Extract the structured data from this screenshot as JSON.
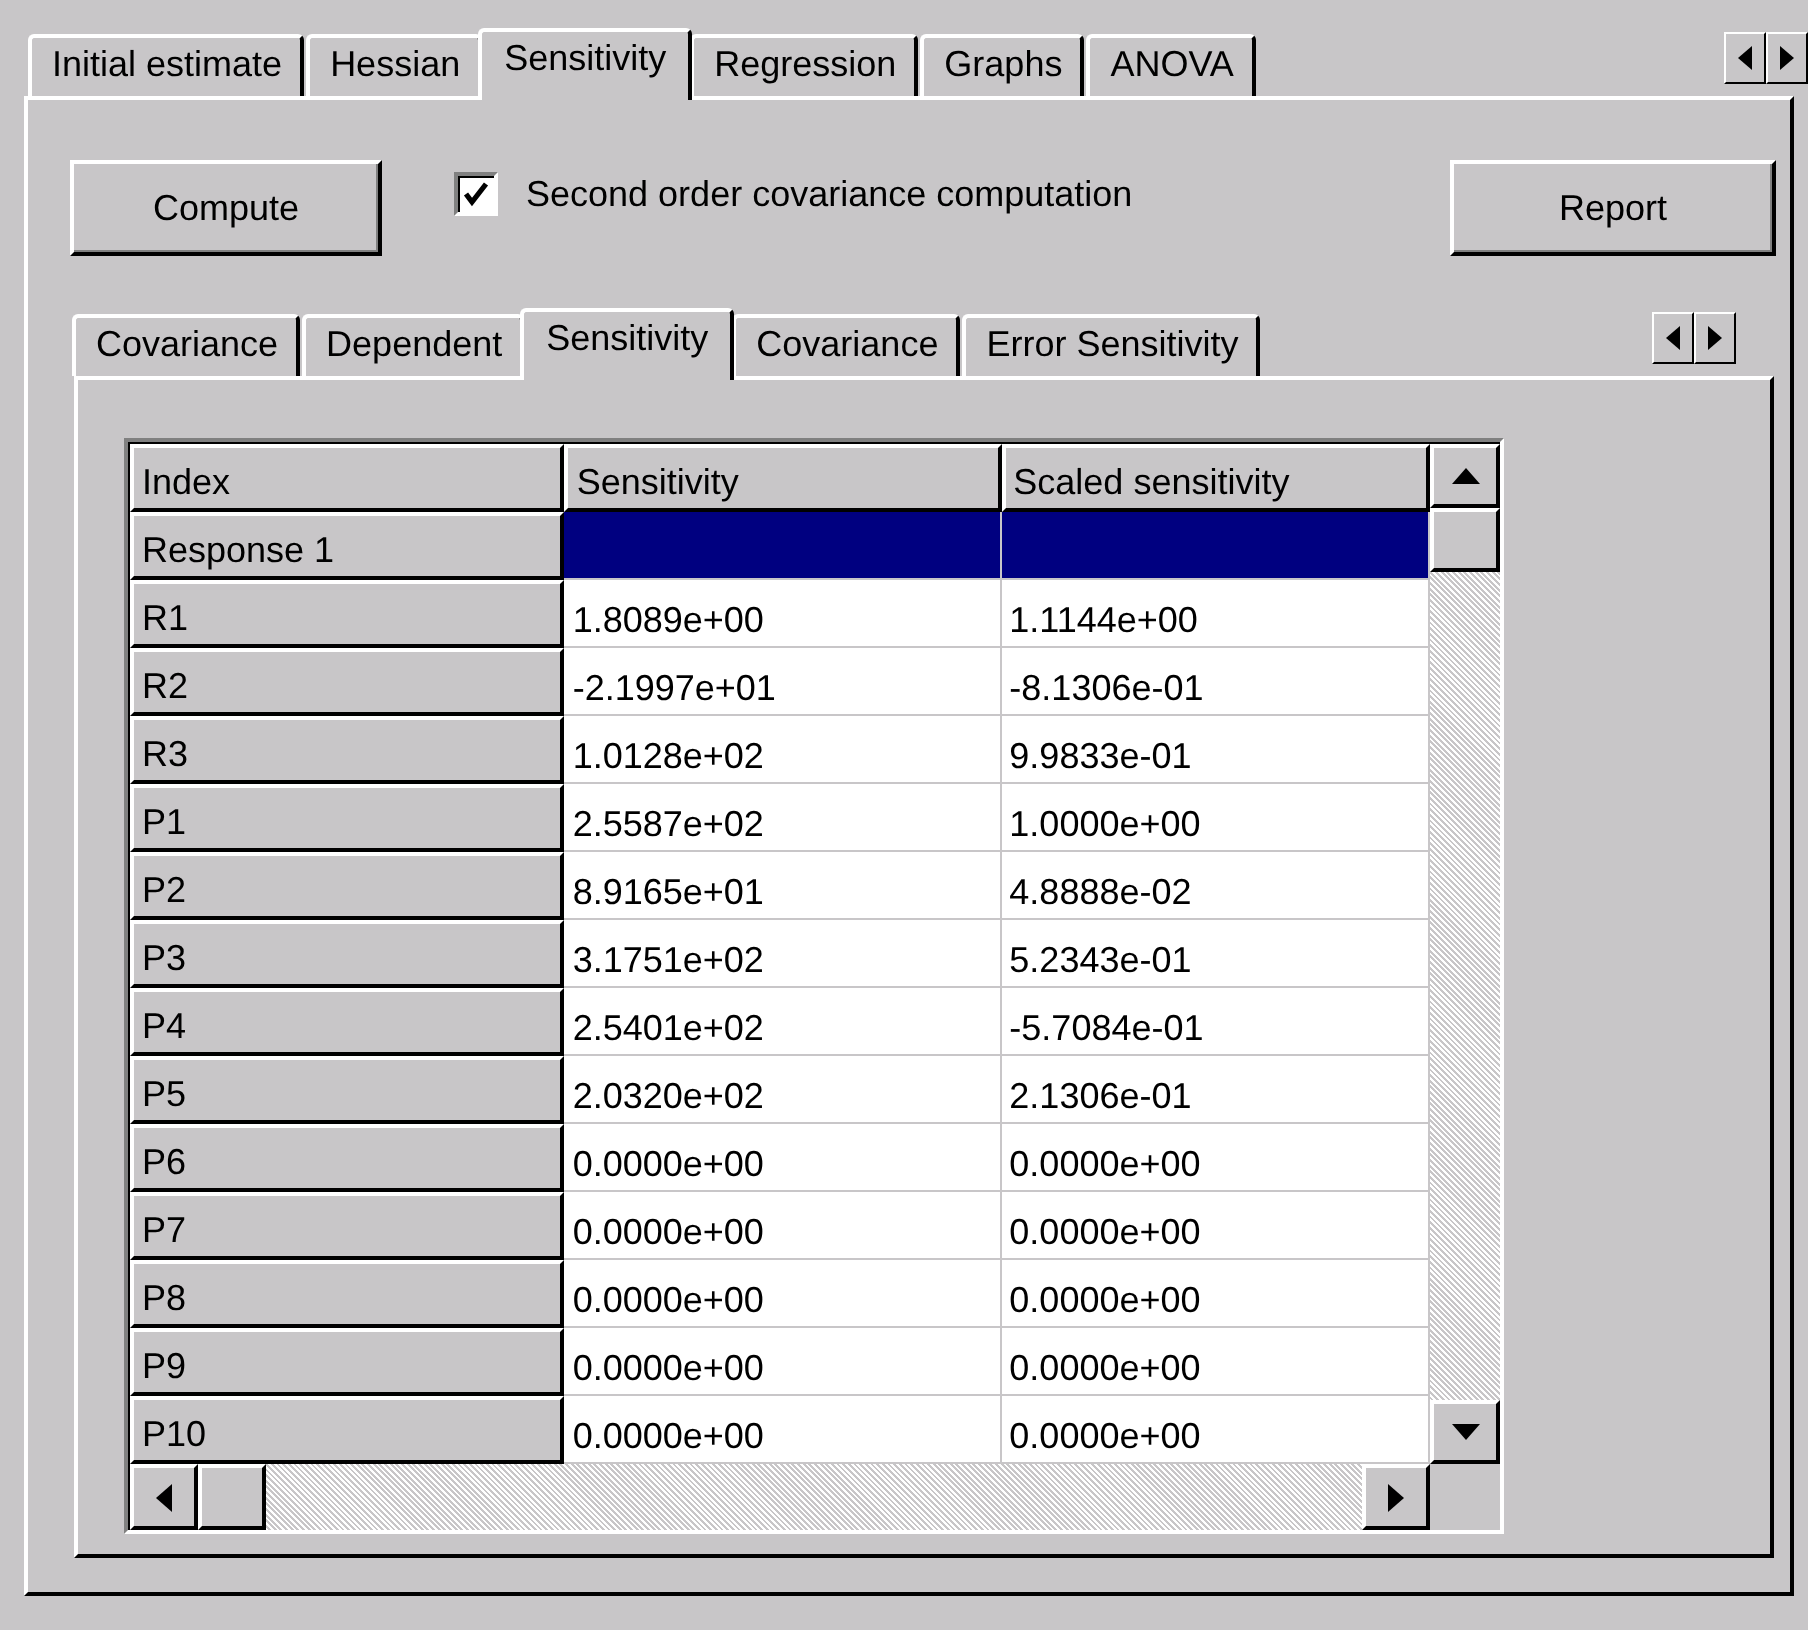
{
  "outer_tabs": [
    {
      "label": "Initial estimate",
      "selected": false
    },
    {
      "label": "Hessian",
      "selected": false
    },
    {
      "label": "Sensitivity",
      "selected": true
    },
    {
      "label": "Regression",
      "selected": false
    },
    {
      "label": "Graphs",
      "selected": false
    },
    {
      "label": "ANOVA",
      "selected": false
    }
  ],
  "toolbar": {
    "compute_button": "Compute",
    "second_order": {
      "label": "Second order covariance computation",
      "checked": true
    },
    "report_button": "Report"
  },
  "inner_tabs": [
    {
      "label": "Covariance",
      "selected": false
    },
    {
      "label": "Dependent",
      "selected": false
    },
    {
      "label": "Sensitivity",
      "selected": true
    },
    {
      "label": "Covariance",
      "selected": false
    },
    {
      "label": "Error Sensitivity",
      "selected": false
    }
  ],
  "table": {
    "columns": [
      "Index",
      "Sensitivity",
      "Scaled sensitivity"
    ],
    "rows": [
      {
        "index": "Response 1",
        "selected": true
      },
      {
        "index": "R1",
        "sensitivity": "1.8089e+00",
        "scaled": "1.1144e+00",
        "selected": false
      },
      {
        "index": "R2",
        "sensitivity": "-2.1997e+01",
        "scaled": "-8.1306e-01",
        "selected": false
      },
      {
        "index": "R3",
        "sensitivity": "1.0128e+02",
        "scaled": "9.9833e-01",
        "selected": false
      },
      {
        "index": "P1",
        "sensitivity": "2.5587e+02",
        "scaled": "1.0000e+00",
        "selected": false
      },
      {
        "index": "P2",
        "sensitivity": "8.9165e+01",
        "scaled": "4.8888e-02",
        "selected": false
      },
      {
        "index": "P3",
        "sensitivity": "3.1751e+02",
        "scaled": "5.2343e-01",
        "selected": false
      },
      {
        "index": "P4",
        "sensitivity": "2.5401e+02",
        "scaled": "-5.7084e-01",
        "selected": false
      },
      {
        "index": "P5",
        "sensitivity": "2.0320e+02",
        "scaled": "2.1306e-01",
        "selected": false
      },
      {
        "index": "P6",
        "sensitivity": "0.0000e+00",
        "scaled": "0.0000e+00",
        "selected": false
      },
      {
        "index": "P7",
        "sensitivity": "0.0000e+00",
        "scaled": "0.0000e+00",
        "selected": false
      },
      {
        "index": "P8",
        "sensitivity": "0.0000e+00",
        "scaled": "0.0000e+00",
        "selected": false
      },
      {
        "index": "P9",
        "sensitivity": "0.0000e+00",
        "scaled": "0.0000e+00",
        "selected": false
      },
      {
        "index": "P10",
        "sensitivity": "0.0000e+00",
        "scaled": "0.0000e+00",
        "selected": false
      }
    ]
  }
}
